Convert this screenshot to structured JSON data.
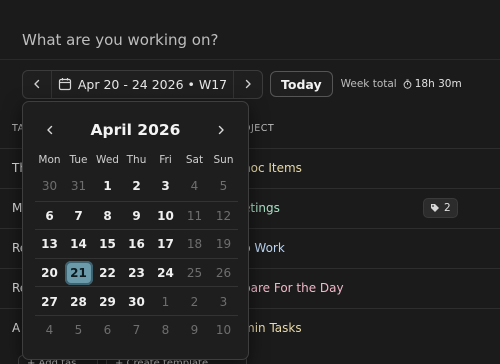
{
  "task_input": {
    "placeholder": "What are you working on?"
  },
  "toolbar": {
    "range_label": "Apr 20 - 24 2026 • W17",
    "today_label": "Today",
    "week_total_label": "Week total",
    "week_total_value": "18h 30m"
  },
  "table": {
    "headers": {
      "task": "TA",
      "project": "OJECT"
    },
    "rows": [
      {
        "task": "Th",
        "project": "hoc Items",
        "project_color": "#e8d9a8"
      },
      {
        "task": "M",
        "project": "etings",
        "project_color": "#a8e0c4",
        "tag_count": "2"
      },
      {
        "task": "Re",
        "project": "p Work",
        "project_color": "#b9d3f0"
      },
      {
        "task": "Re",
        "project": "pare For the Day",
        "project_color": "#f0b8c8"
      },
      {
        "task": "A",
        "project": "min Tasks",
        "project_color": "#e8d9a8"
      }
    ]
  },
  "bottom": {
    "left_btn": "+ Add tas",
    "right_btn": "+ Create template"
  },
  "calendar": {
    "title": "April 2026",
    "weekdays": [
      "Mon",
      "Tue",
      "Wed",
      "Thu",
      "Fri",
      "Sat",
      "Sun"
    ],
    "weeks": [
      [
        "30",
        "31",
        "1",
        "2",
        "3",
        "4",
        "5"
      ],
      [
        "6",
        "7",
        "8",
        "9",
        "10",
        "11",
        "12"
      ],
      [
        "13",
        "14",
        "15",
        "16",
        "17",
        "18",
        "19"
      ],
      [
        "20",
        "21",
        "22",
        "23",
        "24",
        "25",
        "26"
      ],
      [
        "27",
        "28",
        "29",
        "30",
        "1",
        "2",
        "3"
      ],
      [
        "4",
        "5",
        "6",
        "7",
        "8",
        "9",
        "10"
      ]
    ],
    "selected_day": "21"
  }
}
